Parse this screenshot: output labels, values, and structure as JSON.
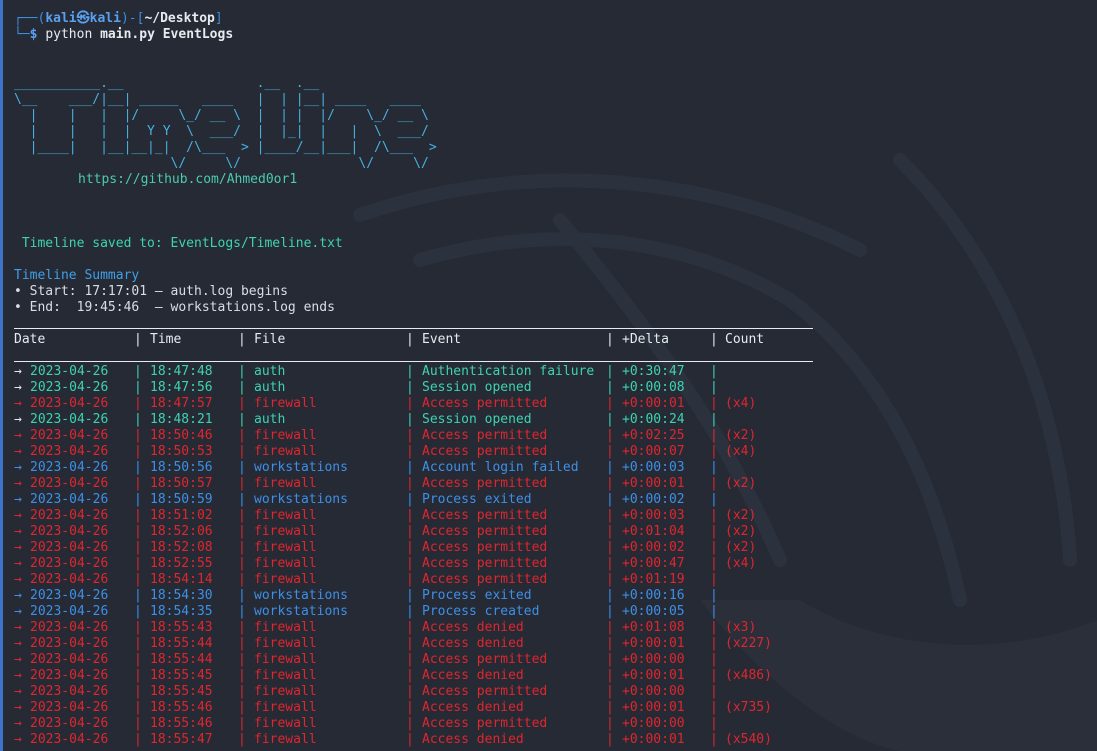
{
  "prompt": {
    "user": "kali",
    "host": "kali",
    "path": "~/Desktop",
    "command": "python",
    "args": "main.py EventLogs"
  },
  "banner": [
    "___________.__                 .__  .__",
    "\\__    ___/|__| _____   ____   |  | |__| ____   ____",
    "  |    |   |  |/     \\_/ __ \\  |  | |  |/    \\_/ __ \\",
    "  |    |   |  |  Y Y  \\  ___/  |  |_|  |   |  \\  ___/",
    "  |____|   |__|__|_|  /\\___  > |____/__|___|  /\\___  >",
    "                    \\/     \\/               \\/     \\/"
  ],
  "url": "https://github.com/Ahmed0or1",
  "saved_message": " Timeline saved to: EventLogs/Timeline.txt",
  "summary": {
    "title": "Timeline Summary",
    "start": "• Start: 17:17:01 — auth.log begins",
    "end": "• End:  19:45:46  — workstations.log ends"
  },
  "table": {
    "headers": [
      "Date",
      "Time",
      "File",
      "Event",
      "+Delta",
      "Count"
    ],
    "rows": [
      {
        "arrow": "→",
        "date": "2023-04-26",
        "time": "18:47:48",
        "file": "auth",
        "event": "Authentication failure",
        "delta": "+0:30:47",
        "count": "",
        "kind": "auth"
      },
      {
        "arrow": "→",
        "date": "2023-04-26",
        "time": "18:47:56",
        "file": "auth",
        "event": "Session opened",
        "delta": "+0:00:08",
        "count": "",
        "kind": "auth"
      },
      {
        "arrow": "→",
        "date": "2023-04-26",
        "time": "18:47:57",
        "file": "firewall",
        "event": "Access permitted",
        "delta": "+0:00:01",
        "count": "(x4)",
        "kind": "fw"
      },
      {
        "arrow": "→",
        "date": "2023-04-26",
        "time": "18:48:21",
        "file": "auth",
        "event": "Session opened",
        "delta": "+0:00:24",
        "count": "",
        "kind": "auth"
      },
      {
        "arrow": "→",
        "date": "2023-04-26",
        "time": "18:50:46",
        "file": "firewall",
        "event": "Access permitted",
        "delta": "+0:02:25",
        "count": "(x2)",
        "kind": "fw"
      },
      {
        "arrow": "→",
        "date": "2023-04-26",
        "time": "18:50:53",
        "file": "firewall",
        "event": "Access permitted",
        "delta": "+0:00:07",
        "count": "(x4)",
        "kind": "fw"
      },
      {
        "arrow": "→",
        "date": "2023-04-26",
        "time": "18:50:56",
        "file": "workstations",
        "event": "Account login failed",
        "delta": "+0:00:03",
        "count": "",
        "kind": "ws"
      },
      {
        "arrow": "→",
        "date": "2023-04-26",
        "time": "18:50:57",
        "file": "firewall",
        "event": "Access permitted",
        "delta": "+0:00:01",
        "count": "(x2)",
        "kind": "fw"
      },
      {
        "arrow": "→",
        "date": "2023-04-26",
        "time": "18:50:59",
        "file": "workstations",
        "event": "Process exited",
        "delta": "+0:00:02",
        "count": "",
        "kind": "ws"
      },
      {
        "arrow": "→",
        "date": "2023-04-26",
        "time": "18:51:02",
        "file": "firewall",
        "event": "Access permitted",
        "delta": "+0:00:03",
        "count": "(x2)",
        "kind": "fw"
      },
      {
        "arrow": "→",
        "date": "2023-04-26",
        "time": "18:52:06",
        "file": "firewall",
        "event": "Access permitted",
        "delta": "+0:01:04",
        "count": "(x2)",
        "kind": "fw"
      },
      {
        "arrow": "→",
        "date": "2023-04-26",
        "time": "18:52:08",
        "file": "firewall",
        "event": "Access permitted",
        "delta": "+0:00:02",
        "count": "(x2)",
        "kind": "fw"
      },
      {
        "arrow": "→",
        "date": "2023-04-26",
        "time": "18:52:55",
        "file": "firewall",
        "event": "Access permitted",
        "delta": "+0:00:47",
        "count": "(x4)",
        "kind": "fw"
      },
      {
        "arrow": "→",
        "date": "2023-04-26",
        "time": "18:54:14",
        "file": "firewall",
        "event": "Access permitted",
        "delta": "+0:01:19",
        "count": "",
        "kind": "fw"
      },
      {
        "arrow": "→",
        "date": "2023-04-26",
        "time": "18:54:30",
        "file": "workstations",
        "event": "Process exited",
        "delta": "+0:00:16",
        "count": "",
        "kind": "ws"
      },
      {
        "arrow": "→",
        "date": "2023-04-26",
        "time": "18:54:35",
        "file": "workstations",
        "event": "Process created",
        "delta": "+0:00:05",
        "count": "",
        "kind": "ws"
      },
      {
        "arrow": "→",
        "date": "2023-04-26",
        "time": "18:55:43",
        "file": "firewall",
        "event": "Access denied",
        "delta": "+0:01:08",
        "count": "(x3)",
        "kind": "fw"
      },
      {
        "arrow": "→",
        "date": "2023-04-26",
        "time": "18:55:44",
        "file": "firewall",
        "event": "Access denied",
        "delta": "+0:00:01",
        "count": "(x227)",
        "kind": "fw"
      },
      {
        "arrow": "→",
        "date": "2023-04-26",
        "time": "18:55:44",
        "file": "firewall",
        "event": "Access permitted",
        "delta": "+0:00:00",
        "count": "",
        "kind": "fw"
      },
      {
        "arrow": "→",
        "date": "2023-04-26",
        "time": "18:55:45",
        "file": "firewall",
        "event": "Access denied",
        "delta": "+0:00:01",
        "count": "(x486)",
        "kind": "fw"
      },
      {
        "arrow": "→",
        "date": "2023-04-26",
        "time": "18:55:45",
        "file": "firewall",
        "event": "Access permitted",
        "delta": "+0:00:00",
        "count": "",
        "kind": "fw"
      },
      {
        "arrow": "→",
        "date": "2023-04-26",
        "time": "18:55:46",
        "file": "firewall",
        "event": "Access denied",
        "delta": "+0:00:01",
        "count": "(x735)",
        "kind": "fw"
      },
      {
        "arrow": "→",
        "date": "2023-04-26",
        "time": "18:55:46",
        "file": "firewall",
        "event": "Access permitted",
        "delta": "+0:00:00",
        "count": "",
        "kind": "fw"
      },
      {
        "arrow": "→",
        "date": "2023-04-26",
        "time": "18:55:47",
        "file": "firewall",
        "event": "Access denied",
        "delta": "+0:00:01",
        "count": "(x540)",
        "kind": "fw"
      }
    ]
  },
  "colors": {
    "background": "#252a34",
    "auth": "#3ed3b0",
    "firewall": "#e0262e",
    "workstations": "#3f8fe8",
    "banner": "#47b0e0"
  }
}
